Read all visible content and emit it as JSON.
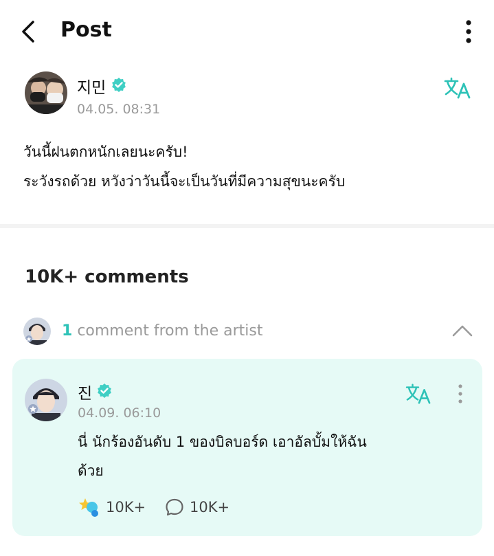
{
  "header": {
    "title": "Post"
  },
  "post": {
    "author": "지민",
    "date": "04.05. 08:31",
    "body_line1": "วันนี้ฝนตกหนักเลยนะครับ!",
    "body_line2": "ระวังรถด้วย หวังว่าวันนี้จะเป็นวันที่มีความสุขนะครับ"
  },
  "comments": {
    "count_label": "10K+ comments",
    "artist_count": "1",
    "artist_label": "comment from the artist"
  },
  "artist_comment": {
    "author": "진",
    "date": "04.09. 06:10",
    "body_line1": "นี่ นักร้องอันดับ 1 ของบิลบอร์ด เอาอัลบั้มให้ฉัน",
    "body_line2": "ด้วย",
    "likes": "10K+",
    "replies": "10K+"
  },
  "colors": {
    "accent": "#2dc2b7",
    "card_bg": "#e6faf6",
    "verified": "#3fcfc4"
  },
  "icons": [
    "back-arrow-icon",
    "more-vertical-icon",
    "verified-badge-icon",
    "translate-icon",
    "chevron-up-icon",
    "cheer-star-icon",
    "reply-bubble-icon"
  ]
}
